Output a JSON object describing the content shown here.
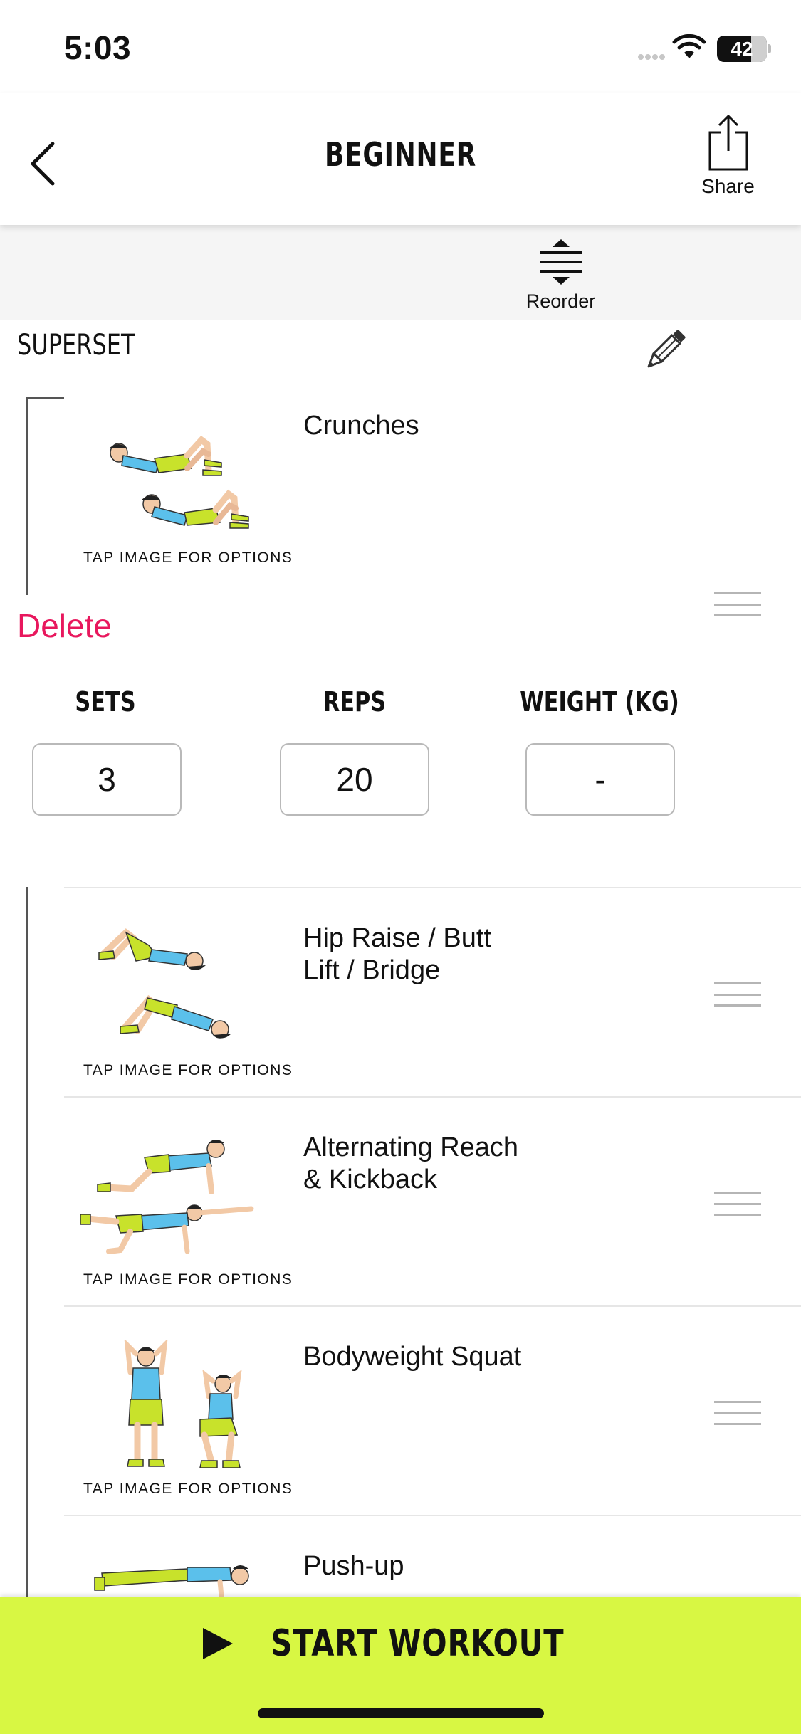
{
  "status": {
    "time": "5:03",
    "battery": "42"
  },
  "nav": {
    "title": "BEGINNER",
    "share_label": "Share"
  },
  "toolbar": {
    "reorder_label": "Reorder"
  },
  "superset": {
    "title": "SUPERSET"
  },
  "tap_label": "TAP IMAGE FOR OPTIONS",
  "exercises": [
    {
      "name": "Crunches"
    },
    {
      "name": "Hip Raise / Butt\nLift / Bridge"
    },
    {
      "name": "Alternating Reach\n& Kickback"
    },
    {
      "name": "Bodyweight Squat"
    },
    {
      "name": "Push-up"
    }
  ],
  "swipe_action": {
    "delete_label": "Delete"
  },
  "stats": {
    "sets_label": "SETS",
    "sets_value": "3",
    "reps_label": "REPS",
    "reps_value": "20",
    "weight_label": "WEIGHT (KG)",
    "weight_value": "-"
  },
  "footer": {
    "start_label": "START WORKOUT"
  },
  "colors": {
    "accent": "#d8f743",
    "delete": "#e8175d",
    "shirt": "#5bc0eb",
    "shorts": "#c8e22b"
  }
}
